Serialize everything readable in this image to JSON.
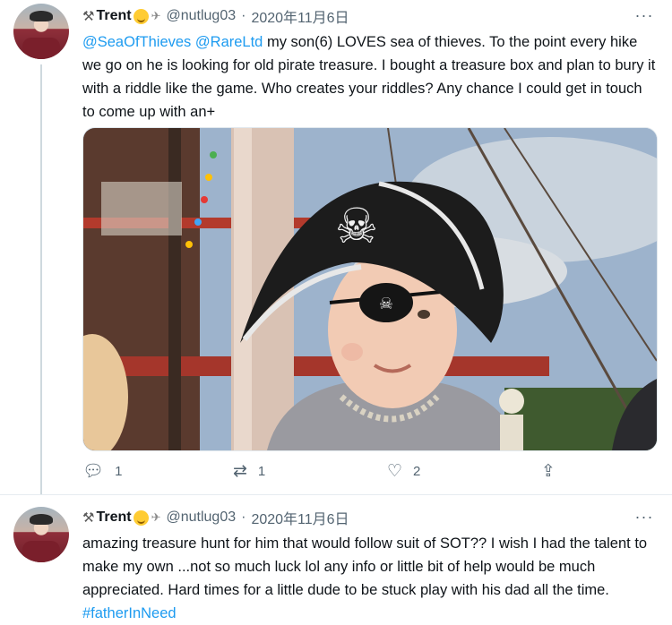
{
  "tweets": [
    {
      "user": {
        "display_name": "Trent",
        "emoji_prefix": "⚒",
        "handle": "@nutlug03",
        "dot": "·",
        "date": "2020年11月6日"
      },
      "text_parts": {
        "mention1": "@SeaOfThieves",
        "mention2": "@RareLtd",
        "body": " my son(6) LOVES sea of thieves. To the point every hike we go on he is looking for old pirate treasure. I bought a treasure box and plan to bury it with a riddle like the game. Who creates your riddles? Any chance I could get in touch to come up with an+"
      },
      "actions": {
        "reply_count": "1",
        "retweet_count": "1",
        "like_count": "2"
      }
    },
    {
      "user": {
        "display_name": "Trent",
        "emoji_prefix": "⚒",
        "handle": "@nutlug03",
        "dot": "·",
        "date": "2020年11月6日"
      },
      "text_parts": {
        "body": "amazing treasure hunt for him that would follow suit of SOT?? I wish I had the talent to make my own ...not so much luck lol any info or little bit of help would be much appreciated.  Hard times for a little dude to be stuck play with his dad all the time. ",
        "hashtag": "#fatherInNeed"
      }
    }
  ],
  "icons": {
    "more": "more-icon",
    "reply": "reply-icon",
    "retweet": "retweet-icon",
    "like": "like-icon",
    "share": "share-icon"
  },
  "colors": {
    "link": "#1d9bf0",
    "meta": "#536471",
    "text": "#0f1419"
  }
}
